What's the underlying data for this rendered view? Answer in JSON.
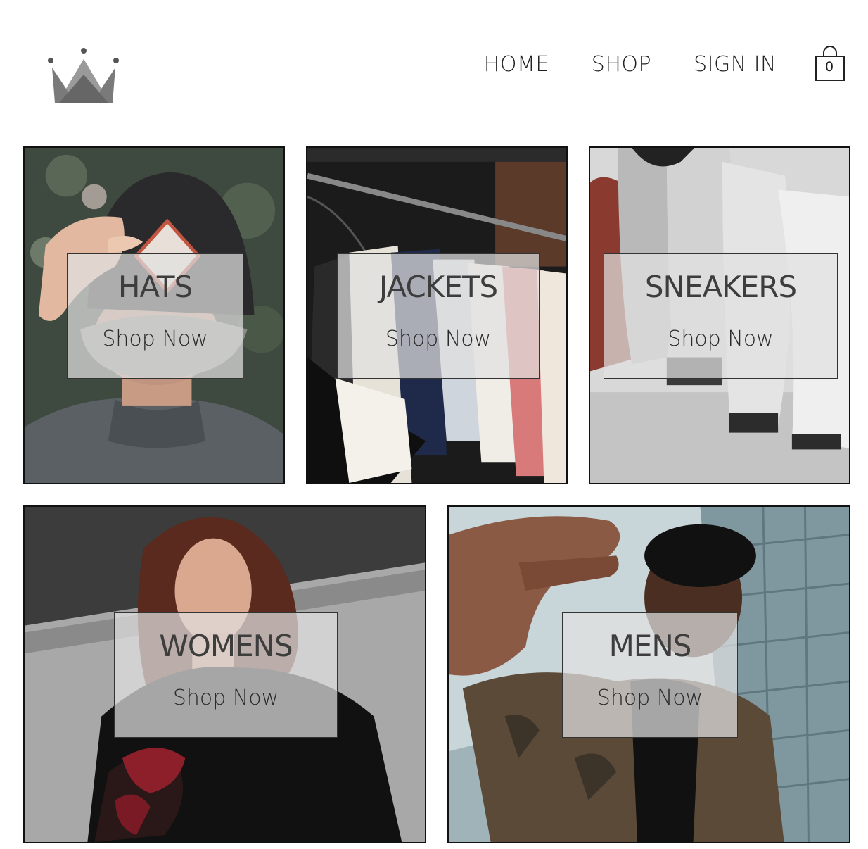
{
  "header": {
    "logo_icon": "crown-icon",
    "nav": {
      "home": "HOME",
      "shop": "SHOP",
      "sign_in": "SIGN IN"
    },
    "cart": {
      "icon": "shopping-bag-icon",
      "count": "0"
    }
  },
  "directory": [
    {
      "title": "HATS",
      "cta": "Shop Now",
      "photo": "man-in-cap-from-behind"
    },
    {
      "title": "JACKETS",
      "cta": "Shop Now",
      "photo": "jackets-on-clothing-rack"
    },
    {
      "title": "SNEAKERS",
      "cta": "Shop Now",
      "photo": "row-of-sneakers"
    },
    {
      "title": "WOMENS",
      "cta": "Shop Now",
      "photo": "woman-in-black-top"
    },
    {
      "title": "MENS",
      "cta": "Shop Now",
      "photo": "man-reaching-toward-camera"
    }
  ],
  "colors": {
    "text": "#222222",
    "label_bg": "#e1e1e1",
    "border": "#111111"
  }
}
